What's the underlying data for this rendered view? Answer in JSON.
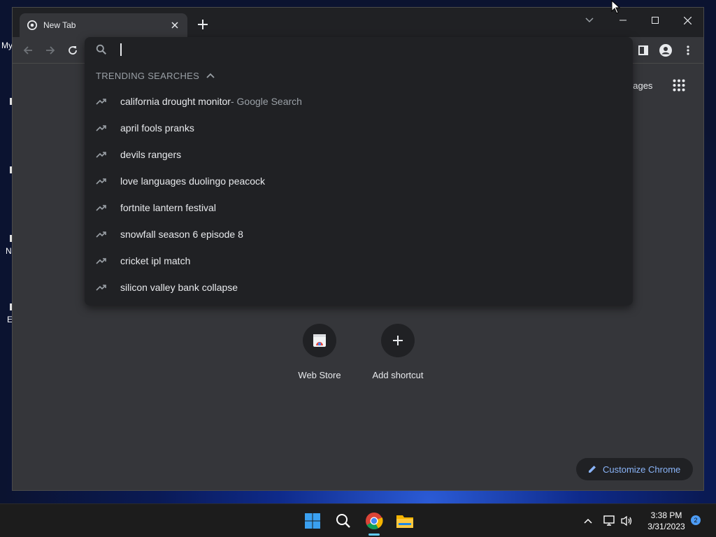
{
  "desktop": {
    "icon_labels": [
      "My",
      "N",
      "E"
    ]
  },
  "browser": {
    "tab": {
      "title": "New Tab",
      "close_icon": "close-icon"
    },
    "new_tab_icon": "plus-icon",
    "window_controls": [
      "chevron-down-icon",
      "minimize-icon",
      "maximize-icon",
      "close-icon"
    ],
    "toolbar": {
      "back_icon": "arrow-left-icon",
      "forward_icon": "arrow-right-icon",
      "reload_icon": "reload-icon",
      "side_panel_icon": "side-panel-icon",
      "profile_icon": "profile-icon",
      "menu_icon": "kebab-menu-icon"
    },
    "omnibox": {
      "value": "",
      "trending_header": "TRENDING SEARCHES",
      "suggestions": [
        {
          "text": "california drought monitor",
          "desc": " - Google Search"
        },
        {
          "text": "april fools pranks",
          "desc": ""
        },
        {
          "text": "devils rangers",
          "desc": ""
        },
        {
          "text": "love languages duolingo peacock",
          "desc": ""
        },
        {
          "text": "fortnite lantern festival",
          "desc": ""
        },
        {
          "text": "snowfall season 6 episode 8",
          "desc": ""
        },
        {
          "text": "cricket ipl match",
          "desc": ""
        },
        {
          "text": "silicon valley bank collapse",
          "desc": ""
        }
      ]
    },
    "ntp": {
      "images_link": "nages",
      "apps_icon": "apps-grid-icon",
      "shortcuts": [
        {
          "label": "Web Store",
          "icon": "web-store-icon"
        },
        {
          "label": "Add shortcut",
          "icon": "plus-icon"
        }
      ],
      "customize_label": "Customize Chrome"
    }
  },
  "taskbar": {
    "apps": [
      "windows-start-icon",
      "search-icon",
      "chrome-icon",
      "file-explorer-icon"
    ],
    "clock_time": "3:38 PM",
    "clock_date": "3/31/2023",
    "notification_count": "2"
  },
  "colors": {
    "accent": "#8ab4f8",
    "omnibox_bg": "#202124",
    "page_bg": "#35363a"
  }
}
